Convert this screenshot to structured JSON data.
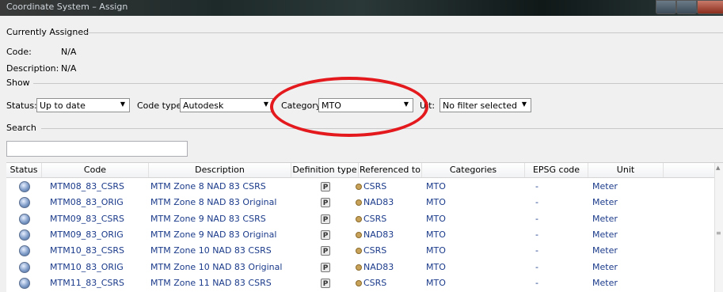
{
  "window": {
    "title": "Coordinate System – Assign"
  },
  "currently_assigned": {
    "section_label": "Currently Assigned",
    "code_label": "Code:",
    "code_value": "N/A",
    "description_label": "Description:",
    "description_value": "N/A"
  },
  "show": {
    "section_label": "Show",
    "status_label": "Status:",
    "status_value": "Up to date",
    "code_type_label": "Code type:",
    "code_type_value": "Autodesk",
    "category_label": "Category:",
    "category_value": "MTO",
    "unit_label_prefix": "U",
    "unit_label_suffix": "it:",
    "unit_value": "No filter selected"
  },
  "search": {
    "section_label": "Search",
    "value": ""
  },
  "table": {
    "headers": [
      "Status",
      "Code",
      "Description",
      "Definition type",
      "Referenced to",
      "Categories",
      "EPSG code",
      "Unit"
    ],
    "rows": [
      {
        "code": "MTM08_83_CSRS",
        "description": "MTM Zone 8 NAD 83 CSRS",
        "def_type": "P",
        "ref": "CSRS",
        "category": "MTO",
        "epsg": "-",
        "unit": "Meter"
      },
      {
        "code": "MTM08_83_ORIG",
        "description": "MTM Zone 8 NAD 83 Original",
        "def_type": "P",
        "ref": "NAD83",
        "category": "MTO",
        "epsg": "-",
        "unit": "Meter"
      },
      {
        "code": "MTM09_83_CSRS",
        "description": "MTM Zone 9 NAD 83 CSRS",
        "def_type": "P",
        "ref": "CSRS",
        "category": "MTO",
        "epsg": "-",
        "unit": "Meter"
      },
      {
        "code": "MTM09_83_ORIG",
        "description": "MTM Zone 9 NAD 83 Original",
        "def_type": "P",
        "ref": "NAD83",
        "category": "MTO",
        "epsg": "-",
        "unit": "Meter"
      },
      {
        "code": "MTM10_83_CSRS",
        "description": "MTM Zone 10 NAD 83 CSRS",
        "def_type": "P",
        "ref": "CSRS",
        "category": "MTO",
        "epsg": "-",
        "unit": "Meter"
      },
      {
        "code": "MTM10_83_ORIG",
        "description": "MTM Zone 10 NAD 83 Original",
        "def_type": "P",
        "ref": "NAD83",
        "category": "MTO",
        "epsg": "-",
        "unit": "Meter"
      },
      {
        "code": "MTM11_83_CSRS",
        "description": "MTM Zone 11 NAD 83 CSRS",
        "def_type": "P",
        "ref": "CSRS",
        "category": "MTO",
        "epsg": "-",
        "unit": "Meter"
      }
    ]
  },
  "colors": {
    "highlight_ellipse": "#e3191e",
    "link_text": "#1a3a8a"
  }
}
